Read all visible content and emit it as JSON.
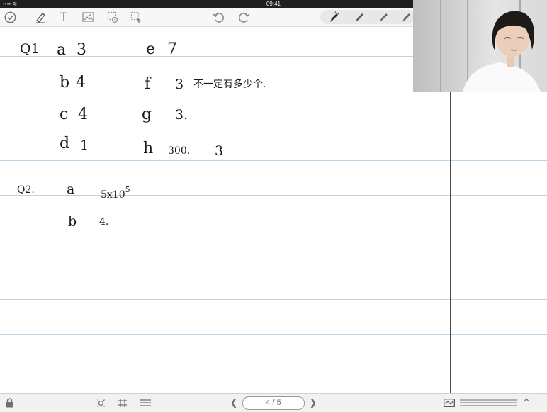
{
  "status_bar": {
    "signal": "••••  ≋",
    "time": "09:41"
  },
  "toolbar": {
    "icons": [
      "check-circle-icon",
      "pen-draw-icon",
      "text-icon",
      "image-icon",
      "lasso-icon",
      "select-icon",
      "undo-icon",
      "redo-icon",
      "pencil-1-icon",
      "pencil-2-icon",
      "pencil-3-icon",
      "pencil-4-icon"
    ],
    "text_glyph": "T"
  },
  "notebook": {
    "q1": {
      "label": "Q1",
      "items": [
        {
          "letter": "a",
          "answer": "3"
        },
        {
          "letter": "b",
          "answer": "4"
        },
        {
          "letter": "c",
          "answer": "4̇"
        },
        {
          "letter": "d",
          "answer": "1"
        },
        {
          "letter": "e",
          "answer": "7"
        },
        {
          "letter": "f",
          "answer": "3",
          "note": "不一定有多少个."
        },
        {
          "letter": "g",
          "answer": "3."
        },
        {
          "letter": "h",
          "answer_a": "300.",
          "answer_b": "3"
        }
      ]
    },
    "q2": {
      "label": "Q2.",
      "items": [
        {
          "letter": "a",
          "answer_base": "5x10",
          "answer_exp": "5"
        },
        {
          "letter": "b",
          "answer": "4."
        }
      ]
    }
  },
  "bottom_bar": {
    "page_indicator": "4 / 5",
    "prev_glyph": "❮",
    "next_glyph": "❯",
    "up_glyph": "⌃"
  }
}
